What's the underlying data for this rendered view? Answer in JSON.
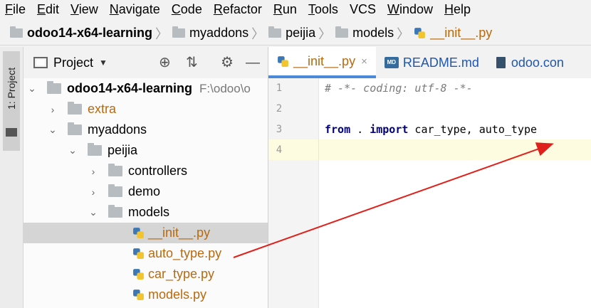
{
  "menubar": {
    "items": [
      {
        "accel": "F",
        "rest": "ile"
      },
      {
        "accel": "E",
        "rest": "dit"
      },
      {
        "accel": "V",
        "rest": "iew"
      },
      {
        "accel": "N",
        "rest": "avigate"
      },
      {
        "accel": "C",
        "rest": "ode"
      },
      {
        "accel": "R",
        "rest": "efactor"
      },
      {
        "accel": "R",
        "rest": "un",
        "pre": ""
      },
      {
        "accel": "T",
        "rest": "ools"
      },
      {
        "accel": "",
        "rest": "VCS"
      },
      {
        "accel": "W",
        "rest": "indow"
      },
      {
        "accel": "H",
        "rest": "elp"
      }
    ]
  },
  "breadcrumb": {
    "project": "odoo14-x64-learning",
    "items": [
      "myaddons",
      "peijia",
      "models"
    ],
    "file": "__init__.py"
  },
  "toolwindow": {
    "strip_label": "1: Project",
    "title": "Project",
    "dropdown_icon": "caret-down-icon",
    "buttons": [
      "target-icon",
      "collapse-icon",
      "gear-icon",
      "minimize-icon"
    ]
  },
  "tree": {
    "root_name": "odoo14-x64-learning",
    "root_path": "F:\\odoo\\o",
    "extra": "extra",
    "myaddons": "myaddons",
    "peijia": "peijia",
    "controllers": "controllers",
    "demo": "demo",
    "models": "models",
    "files": [
      "__init__.py",
      "auto_type.py",
      "car_type.py",
      "models.py"
    ]
  },
  "tabs": [
    {
      "label": "__init__.py",
      "close": "×"
    },
    {
      "label": "README.md",
      "icon_text": "MD"
    },
    {
      "label": "odoo.con"
    }
  ],
  "editor": {
    "line_numbers": [
      "1",
      "2",
      "3",
      "4"
    ],
    "line1": "# -*- coding: utf-8 -*-",
    "line3_kw1": "from",
    "line3_mid": " . ",
    "line3_kw2": "import",
    "line3_rest": " car_type, auto_type"
  },
  "colors": {
    "accent_tab": "#4a8ad8",
    "file_orange": "#b76a10",
    "arrow": "#e0201a"
  }
}
